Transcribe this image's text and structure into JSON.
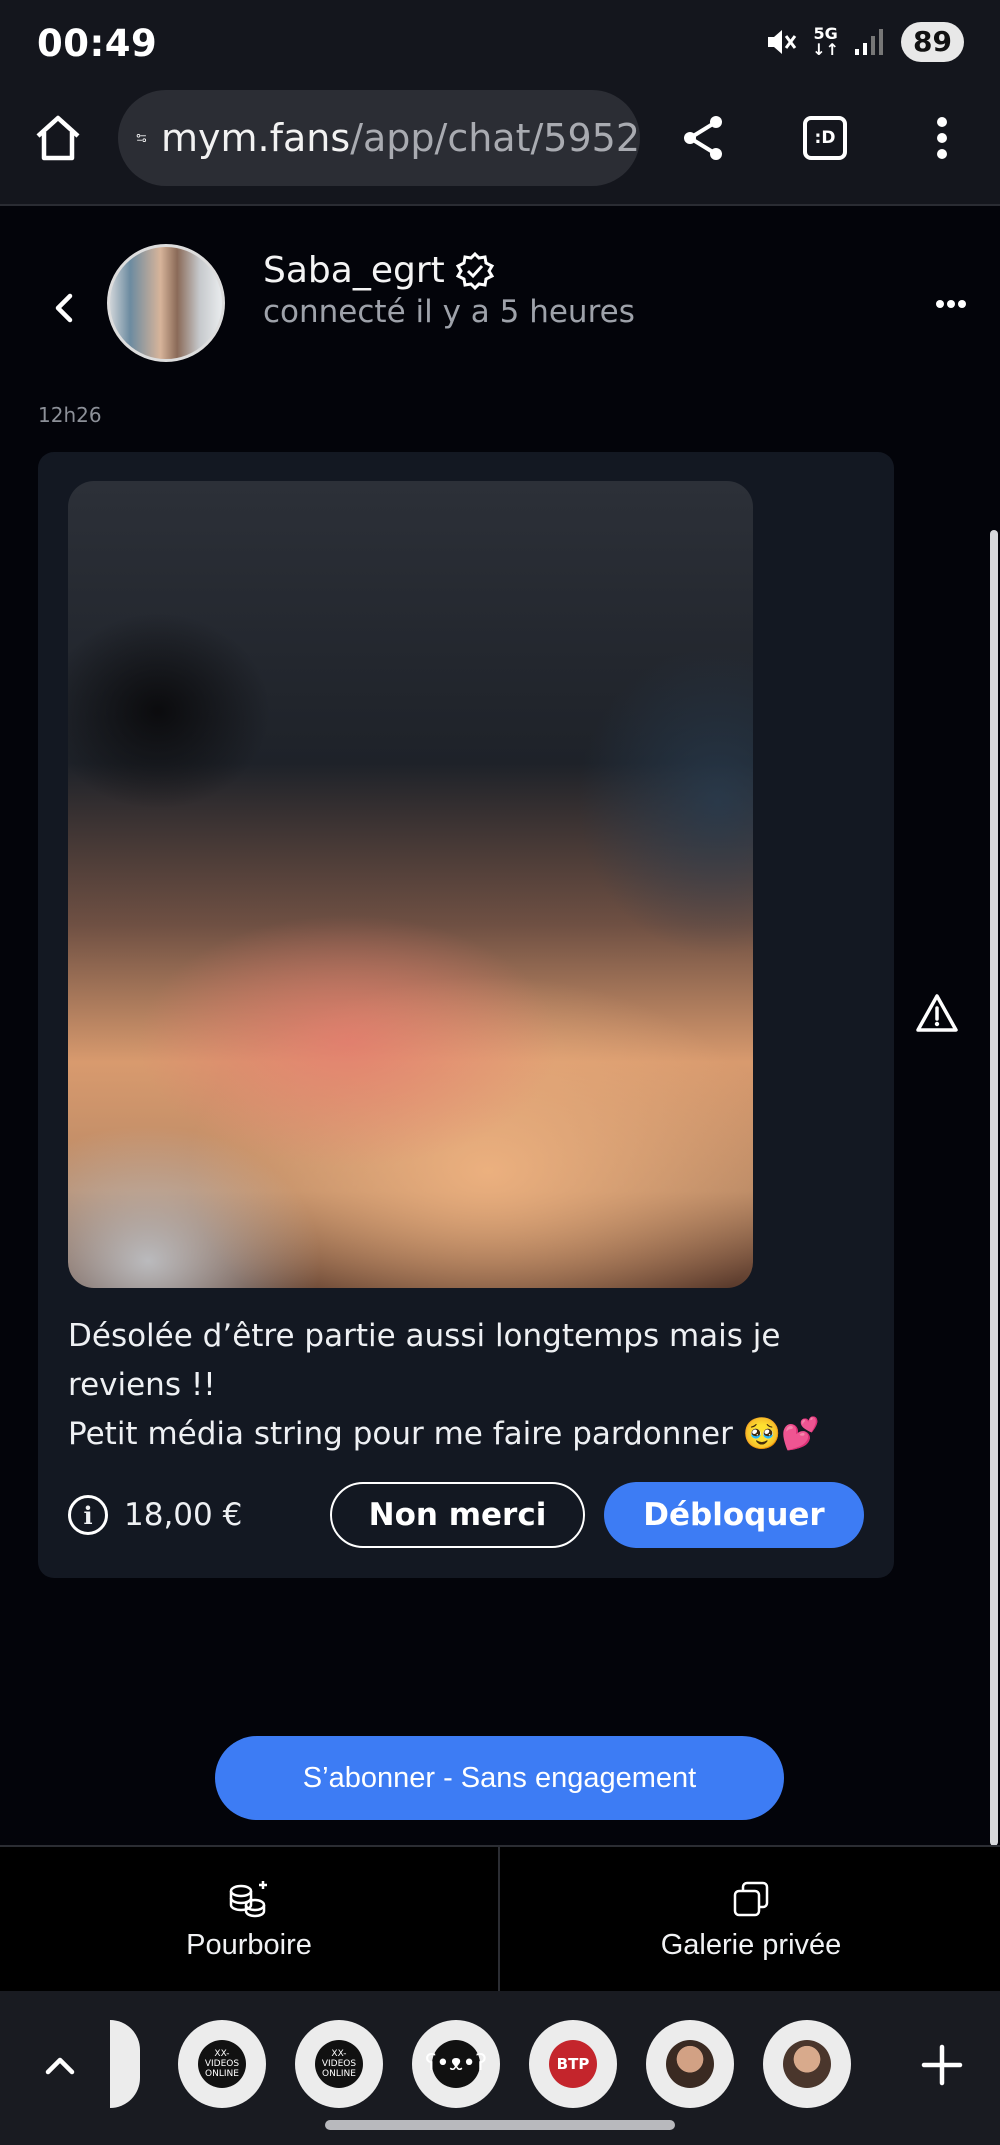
{
  "status_bar": {
    "time": "00:49",
    "network": "5G",
    "battery": "89"
  },
  "browser": {
    "url_host": "mym.fans",
    "url_path": "/app/chat/5952"
  },
  "chat": {
    "username": "Saba_egrt",
    "status": "connecté il y a 5 heures"
  },
  "message": {
    "timestamp": "12h26",
    "line1": "Désolée d’être partie aussi longtemps mais je reviens !!",
    "line2": "Petit média string pour me faire pardonner 🥹💕",
    "price": "18,00 €",
    "decline_label": "Non merci",
    "unlock_label": "Débloquer"
  },
  "subscribe_label": "S’abonner - Sans engagement",
  "actions": {
    "tip_label": "Pourboire",
    "gallery_label": "Galerie privée"
  },
  "tabs": [
    {
      "label": "XX-VIDEOS ONLINE"
    },
    {
      "label": "XX-VIDEOS ONLINE"
    },
    {
      "label": ""
    },
    {
      "label": "BTP"
    },
    {
      "label": ""
    },
    {
      "label": ""
    }
  ],
  "colors": {
    "accent": "#3d7cf4",
    "card": "#131822",
    "background": "#03040a"
  }
}
